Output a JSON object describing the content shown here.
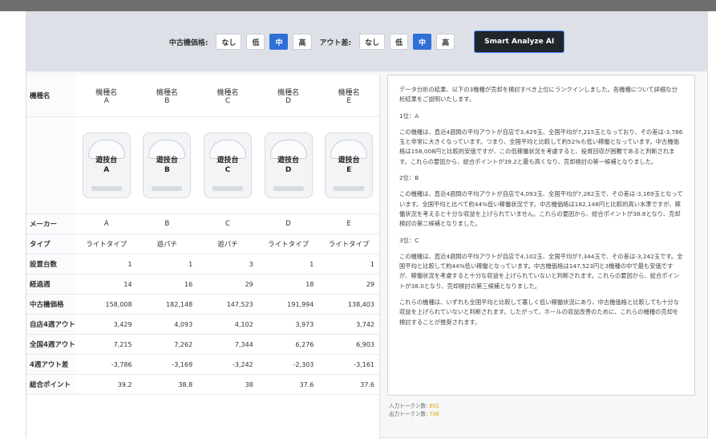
{
  "filters": {
    "used_price": {
      "label": "中古機価格:",
      "options": [
        "なし",
        "低",
        "中",
        "高"
      ],
      "active": "中"
    },
    "out_diff": {
      "label": "アウト差:",
      "options": [
        "なし",
        "低",
        "中",
        "高"
      ],
      "active": "中"
    }
  },
  "ai_button_label": "Smart Analyze AI",
  "table": {
    "header_row_label": "機種名",
    "machines": [
      {
        "name": "機種名\nA",
        "image_label": "遊技台\nA",
        "maker": "A",
        "type": "ライトタイプ",
        "units": "1",
        "weeks": "14",
        "used_price": "158,008",
        "store_out": "3,429",
        "national_out": "7,215",
        "diff": "-3,786",
        "score": "39.2"
      },
      {
        "name": "機種名\nB",
        "image_label": "遊技台\nB",
        "maker": "B",
        "type": "遊パチ",
        "units": "1",
        "weeks": "16",
        "used_price": "182,148",
        "store_out": "4,093",
        "national_out": "7,262",
        "diff": "-3,169",
        "score": "38.8"
      },
      {
        "name": "機種名\nC",
        "image_label": "遊技台\nC",
        "maker": "C",
        "type": "遊パチ",
        "units": "3",
        "weeks": "29",
        "used_price": "147,523",
        "store_out": "4,102",
        "national_out": "7,344",
        "diff": "-3,242",
        "score": "38"
      },
      {
        "name": "機種名\nD",
        "image_label": "遊技台\nD",
        "maker": "D",
        "type": "ライトタイプ",
        "units": "1",
        "weeks": "18",
        "used_price": "191,994",
        "store_out": "3,973",
        "national_out": "6,276",
        "diff": "-2,303",
        "score": "37.6"
      },
      {
        "name": "機種名\nE",
        "image_label": "遊技台\nE",
        "maker": "E",
        "type": "ライトタイプ",
        "units": "1",
        "weeks": "29",
        "used_price": "138,403",
        "store_out": "3,742",
        "national_out": "6,903",
        "diff": "-3,161",
        "score": "37.6"
      }
    ],
    "row_labels": {
      "maker": "メーカー",
      "type": "タイプ",
      "units": "設置台数",
      "weeks": "経過週",
      "used_price": "中古機価格",
      "store_out": "自店4週アウト",
      "national_out": "全国4週アウト",
      "diff": "4週アウト差",
      "score": "総合ポイント"
    }
  },
  "analysis": {
    "paragraphs": [
      "データ分析の結果、以下の3機種が売却を検討すべき上位にランクインしました。各機種について詳細な分析結果をご説明いたします。",
      "1位：A",
      "この機種は、直近4週間の平均アウトが自店で3,429玉、全国平均が7,215玉となっており、その差は-3,786玉と非常に大きくなっています。つまり、全国平均と比較して約52%も低い稼働となっています。中古機価格は158,008円と比較的安価ですが、この低稼働状況を考慮すると、投資回収が困難であると判断されます。これらの要因から、総合ポイントが39.2と最も高くなり、売却検討の第一候補となりました。",
      "2位：B",
      "この機種は、直近4週間の平均アウトが自店で4,093玉、全国平均が7,262玉で、その差は-3,169玉となっています。全国平均と比べて約44%低い稼働状況です。中古機価格は182,148円と比較的高い水準ですが、稼働状況を考えると十分な収益を上げられていません。これらの要因から、総合ポイントが38.8となり、売却検討の第二候補となりました。",
      "3位：C",
      "この機種は、直近4週間の平均アウトが自店で4,102玉、全国平均が7,344玉で、その差は-3,242玉です。全国平均と比較して約44%低い稼働となっています。中古機価格は147,523円と3機種の中で最も安価ですが、稼働状況を考慮すると十分な収益を上げられていないと判断されます。これらの要因から、総合ポイントが38.0となり、売却検討の第三候補となりました。",
      "これらの機種は、いずれも全国平均と比較して著しく低い稼働状況にあり、中古機価格と比較しても十分な収益を上げられていないと判断されます。したがって、ホールの収益改善のために、これらの機種の売却を検討することが推奨されます。"
    ]
  },
  "tokens": {
    "input_label": "入力トークン数:",
    "input_value": "601",
    "output_label": "出力トークン数:",
    "output_value": "706"
  }
}
